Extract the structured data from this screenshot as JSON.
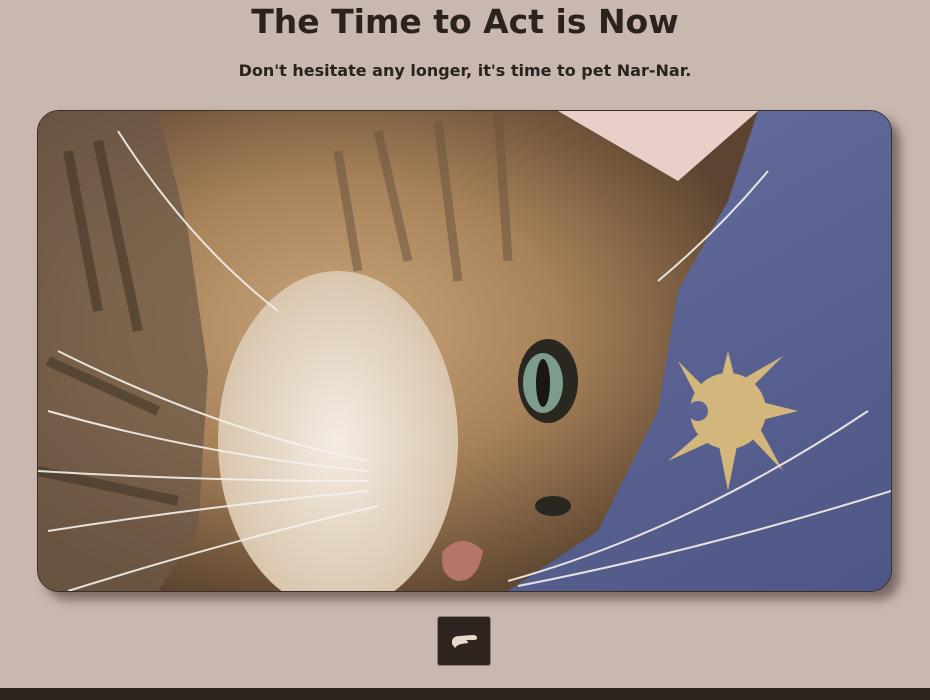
{
  "header": {
    "title": "The Time to Act is Now",
    "subtitle": "Don't hesitate any longer, it's time to pet Nar-Nar."
  },
  "photo": {
    "subject_icon": "cat-photo"
  },
  "pet_button": {
    "icon": "petting-hand-icon"
  },
  "colors": {
    "background": "#c9b8b0",
    "text": "#2b211d",
    "button": "#2e2420",
    "footer": "#2e2420"
  }
}
